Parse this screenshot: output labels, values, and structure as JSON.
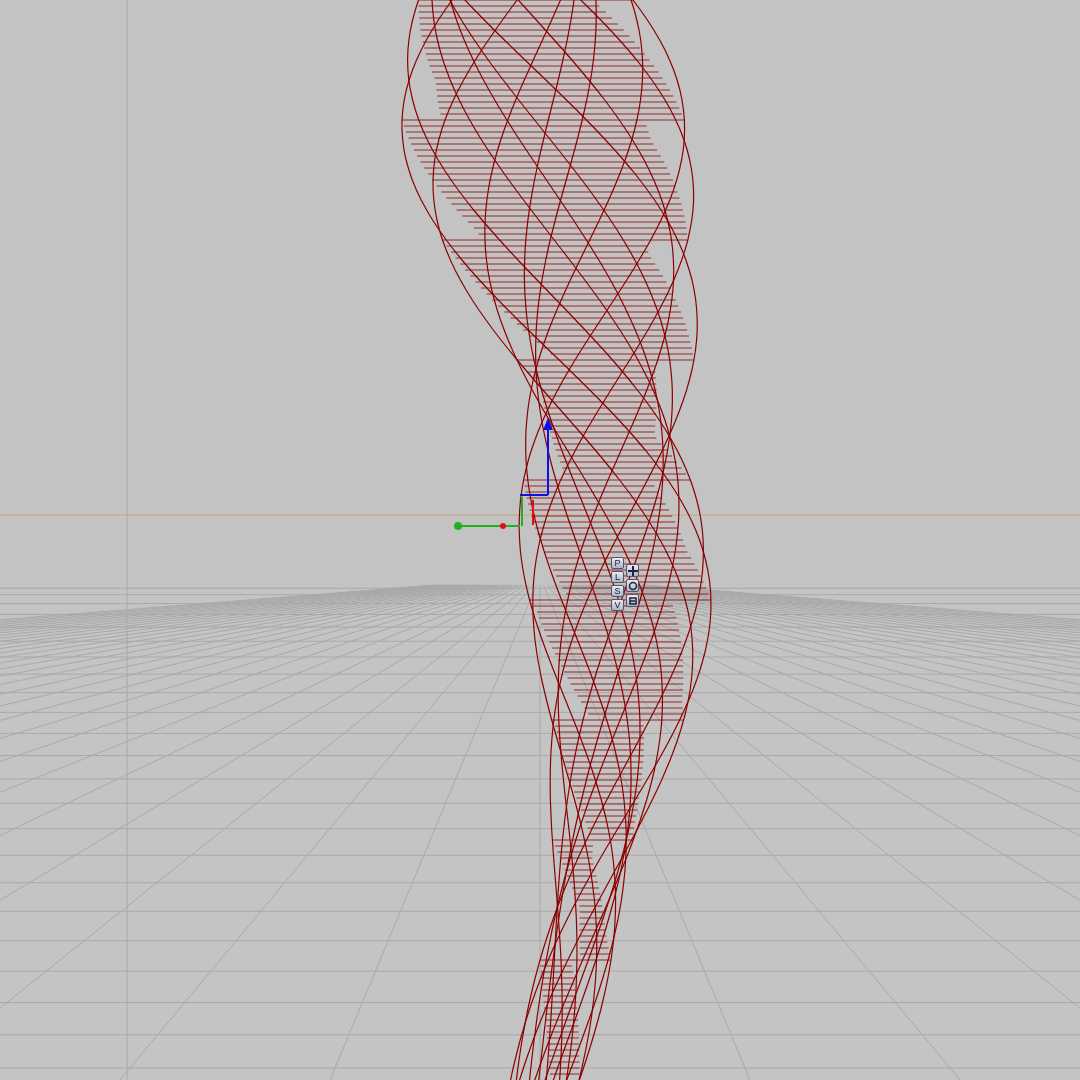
{
  "viewport": {
    "view_buttons": [
      {
        "label": "P"
      },
      {
        "label": "L"
      },
      {
        "label": "S"
      },
      {
        "label": "V"
      }
    ]
  }
}
